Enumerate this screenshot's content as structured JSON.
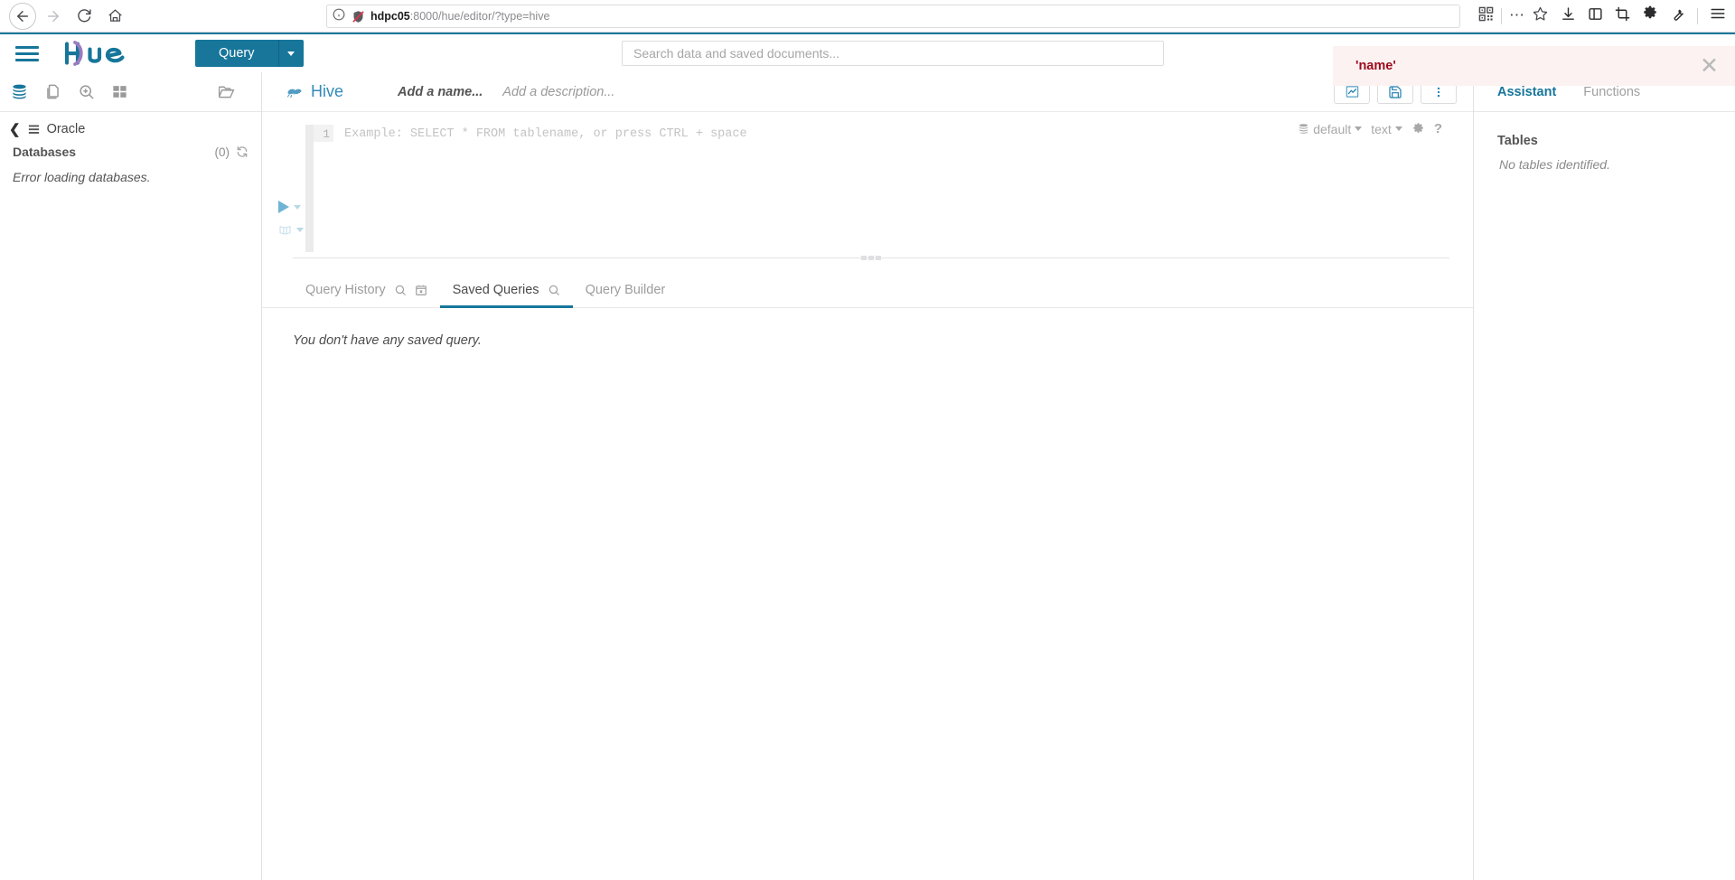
{
  "browser": {
    "back_label": "back",
    "forward_label": "forward",
    "reload_label": "reload",
    "home_label": "home",
    "url_host": "hdpc05",
    "url_rest": ":8000/hue/editor/?type=hive",
    "icons": [
      "qr-code-icon",
      "ellipsis-icon",
      "star-icon",
      "download-icon",
      "sidebar-icon",
      "crop-icon",
      "gear-icon",
      "wrench-icon",
      "menu-icon"
    ]
  },
  "topnav": {
    "logo_text": "hue",
    "query_button": "Query",
    "search_placeholder": "Search data and saved documents..."
  },
  "alert": {
    "message": "'name'",
    "close_label": "✕"
  },
  "left_panel": {
    "icons": [
      "database-icon",
      "documents-icon",
      "search-icon",
      "grid-icon",
      "folder-icon"
    ],
    "breadcrumb_source": "Oracle",
    "databases_label": "Databases",
    "databases_count": "(0)",
    "error_text": "Error loading databases."
  },
  "editor": {
    "app_label": "Hive",
    "name_placeholder": "Add a name...",
    "description_placeholder": "Add a description...",
    "buttons": [
      "chart-icon",
      "save-icon",
      "more-vertical-icon"
    ],
    "settings": {
      "database": "default",
      "format": "text",
      "gear": "gear-icon",
      "help": "?"
    },
    "line_number": "1",
    "code_placeholder": "Example: SELECT * FROM tablename, or press CTRL + space"
  },
  "results": {
    "tabs": [
      {
        "label": "Query History",
        "active": false,
        "icons": [
          "search-icon",
          "calendar-icon"
        ]
      },
      {
        "label": "Saved Queries",
        "active": true,
        "icons": [
          "search-icon"
        ]
      },
      {
        "label": "Query Builder",
        "active": false,
        "icons": []
      }
    ],
    "empty_message": "You don't have any saved query."
  },
  "right_panel": {
    "tabs": [
      {
        "label": "Assistant",
        "active": true
      },
      {
        "label": "Functions",
        "active": false
      }
    ],
    "section_title": "Tables",
    "empty_text": "No tables identified."
  },
  "colors": {
    "brand": "#17769a",
    "alert_text": "#9c0b1c",
    "alert_bg": "#fcf2f2"
  }
}
